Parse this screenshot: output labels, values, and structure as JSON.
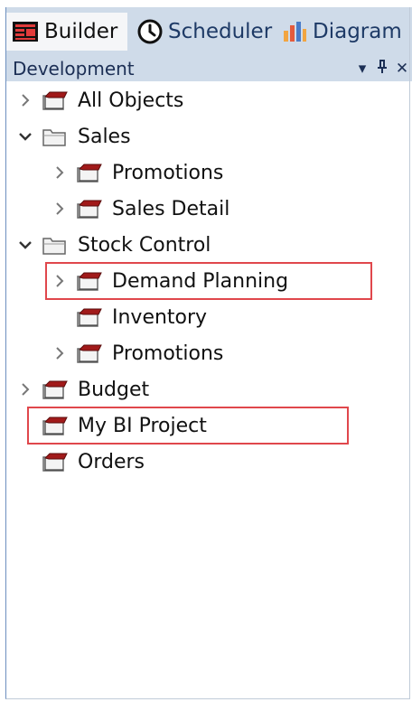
{
  "tabs": [
    {
      "label": "Builder",
      "icon": "builder-icon",
      "active": true
    },
    {
      "label": "Scheduler",
      "icon": "clock-icon",
      "active": false
    },
    {
      "label": "Diagram",
      "icon": "bar-chart-icon",
      "active": false
    }
  ],
  "panel": {
    "title": "Development",
    "buttons": [
      "dropdown-icon",
      "pin-icon",
      "close-icon"
    ]
  },
  "tree": [
    {
      "label": "All Objects",
      "level": 0,
      "expander": "collapsed",
      "folder": "red"
    },
    {
      "label": "Sales",
      "level": 0,
      "expander": "expanded",
      "folder": "open"
    },
    {
      "label": "Promotions",
      "level": 1,
      "expander": "collapsed",
      "folder": "red"
    },
    {
      "label": "Sales Detail",
      "level": 1,
      "expander": "collapsed",
      "folder": "red"
    },
    {
      "label": "Stock Control",
      "level": 0,
      "expander": "expanded",
      "folder": "open"
    },
    {
      "label": "Demand Planning",
      "level": 1,
      "expander": "collapsed",
      "folder": "red",
      "highlighted": true
    },
    {
      "label": "Inventory",
      "level": 1,
      "expander": "none",
      "folder": "red"
    },
    {
      "label": "Promotions",
      "level": 1,
      "expander": "collapsed",
      "folder": "red"
    },
    {
      "label": "Budget",
      "level": 0,
      "expander": "collapsed",
      "folder": "red"
    },
    {
      "label": "My BI Project",
      "level": 0,
      "expander": "none",
      "folder": "red",
      "highlighted": true
    },
    {
      "label": "Orders",
      "level": 0,
      "expander": "none",
      "folder": "red"
    }
  ],
  "colors": {
    "highlight": "#e0474c",
    "tab_bar": "#cfdbe9",
    "folder_red": "#9e1b1b"
  }
}
